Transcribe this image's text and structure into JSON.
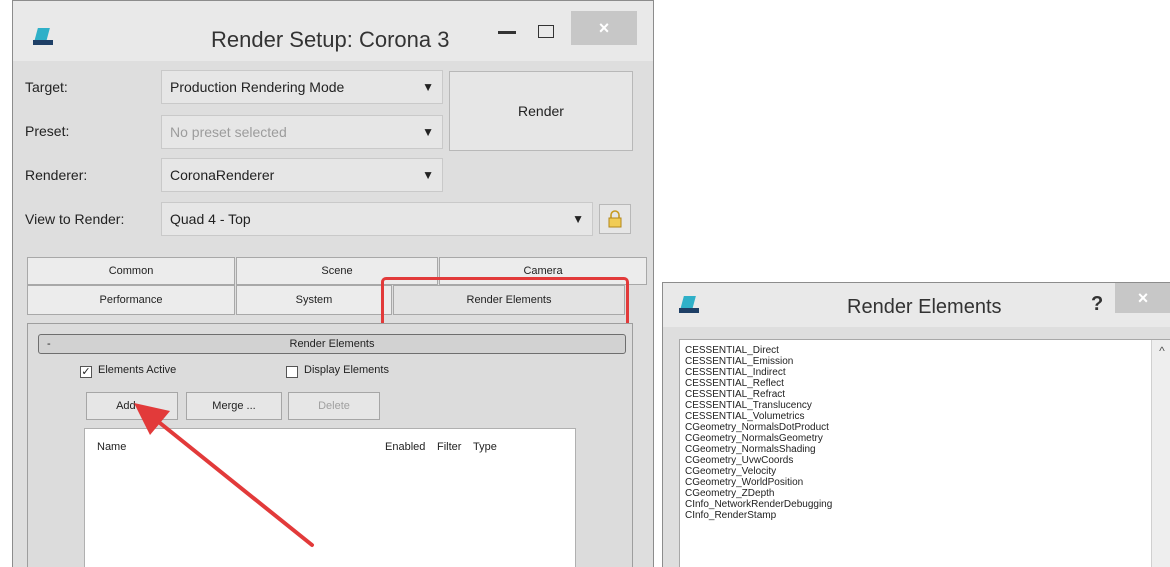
{
  "render_setup": {
    "title": "Render Setup: Corona 3",
    "target_label": "Target:",
    "target_value": "Production Rendering Mode",
    "preset_label": "Preset:",
    "preset_value": "No preset selected",
    "renderer_label": "Renderer:",
    "renderer_value": "CoronaRenderer",
    "view_label": "View to Render:",
    "view_value": "Quad 4 - Top",
    "render_button": "Render",
    "tabs_row1": [
      "Common",
      "Scene",
      "Camera"
    ],
    "tabs_row2": [
      "Performance",
      "System",
      "Render Elements"
    ],
    "rollout_collapse": "-",
    "rollout_title": "Render Elements",
    "elements_active_label": "Elements Active",
    "display_elements_label": "Display Elements",
    "add_button": "Add ...",
    "merge_button": "Merge ...",
    "delete_button": "Delete",
    "columns": {
      "name": "Name",
      "enabled": "Enabled",
      "filter": "Filter",
      "type": "Type"
    }
  },
  "render_elements_dialog": {
    "title": "Render Elements",
    "help": "?",
    "items": [
      "CESSENTIAL_Direct",
      "CESSENTIAL_Emission",
      "CESSENTIAL_Indirect",
      "CESSENTIAL_Reflect",
      "CESSENTIAL_Refract",
      "CESSENTIAL_Translucency",
      "CESSENTIAL_Volumetrics",
      "CGeometry_NormalsDotProduct",
      "CGeometry_NormalsGeometry",
      "CGeometry_NormalsShading",
      "CGeometry_UvwCoords",
      "CGeometry_Velocity",
      "CGeometry_WorldPosition",
      "CGeometry_ZDepth",
      "CInfo_NetworkRenderDebugging",
      "CInfo_RenderStamp"
    ]
  },
  "icons": {
    "app": "3ds-max-logo-icon",
    "minimize": "minimize-icon",
    "maximize": "maximize-icon",
    "close": "close-icon",
    "lock": "lock-icon",
    "dropdown": "chevron-down-icon",
    "scroll_up": "scroll-up-icon",
    "annotation": "red-arrow-annotation"
  },
  "colors": {
    "highlight": "#e23a3a",
    "app_icon": "#2fb0c8"
  }
}
